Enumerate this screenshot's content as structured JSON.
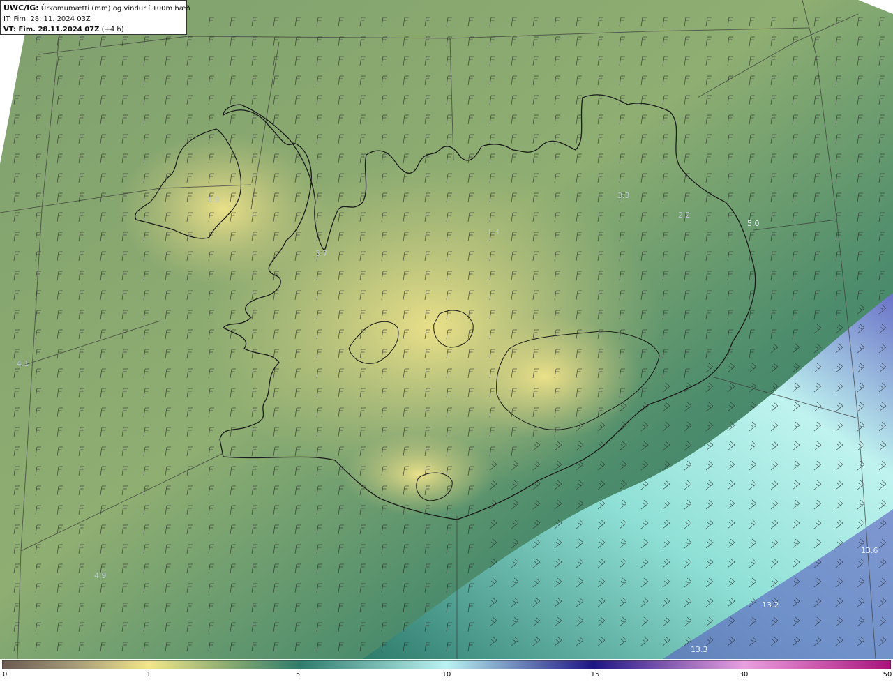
{
  "header": {
    "code": "UWC/IG:",
    "title": "Úrkomumætti (mm) og vindur í 100m hæð",
    "it_line": "IT: Fim. 28. 11. 2024 03Z",
    "vt_label": "VT: Fim. 28.11.2024 07Z",
    "vt_suffix": "(+4 h)"
  },
  "map": {
    "value_labels": [
      "1.9",
      "3.7",
      "1.3",
      "3.3",
      "2.2",
      "5.0",
      "4.1",
      "4.9",
      "13.6",
      "13.2",
      "13.3"
    ]
  },
  "colorbar": {
    "ticks": [
      "0",
      "1",
      "5",
      "10",
      "15",
      "30",
      "50"
    ],
    "colors": [
      "#6a5a52",
      "#c9c07a",
      "#f2e58c",
      "#2f7c6c",
      "#b9f2f2",
      "#1d1680",
      "#e9a0e0",
      "#a8127a"
    ]
  }
}
